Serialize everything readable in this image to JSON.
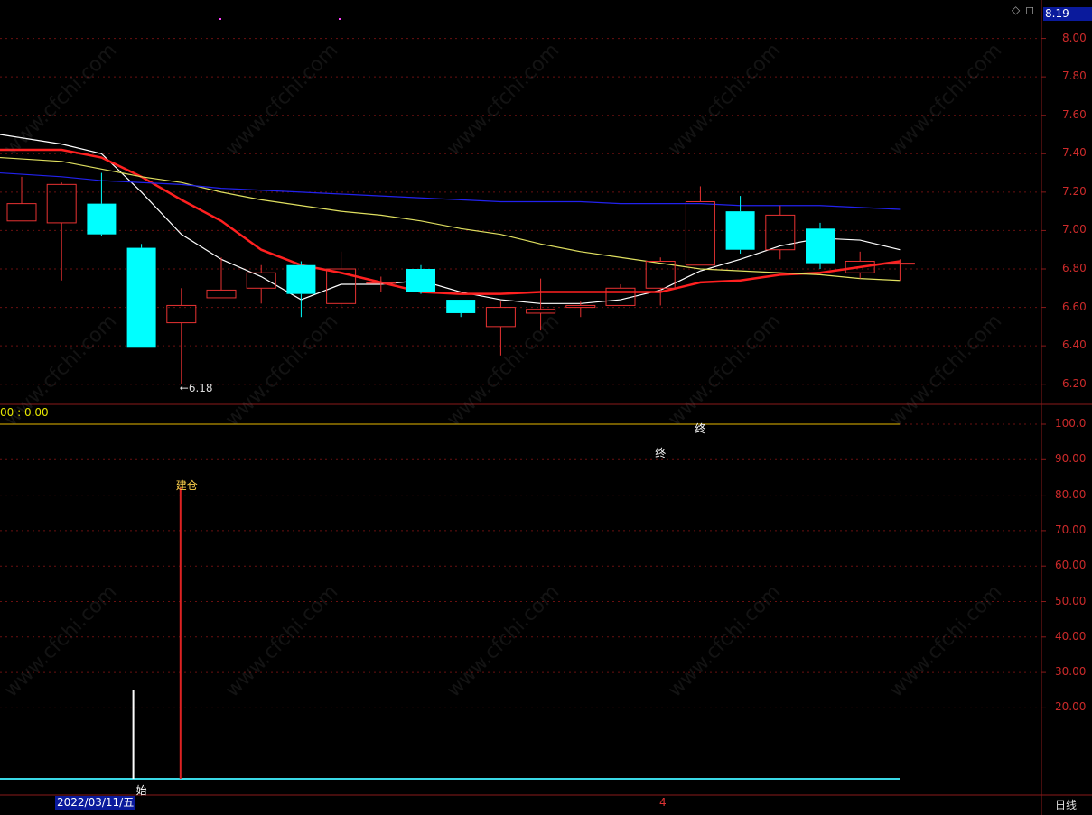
{
  "header": {
    "current_price": "8.19",
    "icons": [
      "diamond-icon",
      "window-icon"
    ]
  },
  "chart_data": [
    {
      "type": "candlestick",
      "panel": "price",
      "ylim": [
        6.1,
        8.2
      ],
      "yticks": [
        "8.00",
        "7.80",
        "7.60",
        "7.40",
        "7.20",
        "7.00",
        "6.80",
        "6.60",
        "6.40",
        "6.20"
      ],
      "candles": [
        {
          "o": 7.05,
          "h": 7.28,
          "l": 7.05,
          "c": 7.14
        },
        {
          "o": 7.04,
          "h": 7.25,
          "l": 6.74,
          "c": 7.24
        },
        {
          "o": 7.14,
          "h": 7.3,
          "l": 6.97,
          "c": 6.98
        },
        {
          "o": 6.91,
          "h": 6.93,
          "l": 6.39,
          "c": 6.39
        },
        {
          "o": 6.52,
          "h": 6.7,
          "l": 6.2,
          "c": 6.61
        },
        {
          "o": 6.65,
          "h": 6.86,
          "l": 6.65,
          "c": 6.69
        },
        {
          "o": 6.7,
          "h": 6.82,
          "l": 6.62,
          "c": 6.78
        },
        {
          "o": 6.82,
          "h": 6.84,
          "l": 6.55,
          "c": 6.67
        },
        {
          "o": 6.62,
          "h": 6.89,
          "l": 6.6,
          "c": 6.8
        },
        {
          "o": 6.73,
          "h": 6.76,
          "l": 6.68,
          "c": 6.73
        },
        {
          "o": 6.8,
          "h": 6.82,
          "l": 6.67,
          "c": 6.68
        },
        {
          "o": 6.64,
          "h": 6.64,
          "l": 6.55,
          "c": 6.57
        },
        {
          "o": 6.5,
          "h": 6.63,
          "l": 6.35,
          "c": 6.6
        },
        {
          "o": 6.57,
          "h": 6.75,
          "l": 6.48,
          "c": 6.59
        },
        {
          "o": 6.6,
          "h": 6.63,
          "l": 6.55,
          "c": 6.61
        },
        {
          "o": 6.61,
          "h": 6.72,
          "l": 6.61,
          "c": 6.7
        },
        {
          "o": 6.7,
          "h": 6.86,
          "l": 6.61,
          "c": 6.84
        },
        {
          "o": 6.82,
          "h": 7.23,
          "l": 6.82,
          "c": 7.15
        },
        {
          "o": 7.1,
          "h": 7.18,
          "l": 6.88,
          "c": 6.9
        },
        {
          "o": 6.9,
          "h": 7.13,
          "l": 6.85,
          "c": 7.08
        },
        {
          "o": 7.01,
          "h": 7.04,
          "l": 6.8,
          "c": 6.83
        },
        {
          "o": 6.78,
          "h": 6.89,
          "l": 6.75,
          "c": 6.84
        },
        {
          "o": 6.83,
          "h": 6.85,
          "l": 6.74,
          "c": 6.83
        }
      ],
      "moving_averages": [
        {
          "color": "#ffffff",
          "values": [
            7.5,
            7.45,
            7.4,
            7.2,
            6.98,
            6.85,
            6.76,
            6.64,
            6.72,
            6.72,
            6.74,
            6.68,
            6.64,
            6.62,
            6.62,
            6.64,
            6.69,
            6.79,
            6.85,
            6.92,
            6.96,
            6.95,
            6.9
          ]
        },
        {
          "color": "#ff2020",
          "values": [
            7.42,
            7.42,
            7.38,
            7.28,
            7.16,
            7.05,
            6.9,
            6.82,
            6.78,
            6.73,
            6.68,
            6.67,
            6.67,
            6.68,
            6.68,
            6.68,
            6.68,
            6.73,
            6.74,
            6.77,
            6.78,
            6.81,
            6.84
          ]
        },
        {
          "color": "#e0e060",
          "values": [
            7.38,
            7.36,
            7.32,
            7.28,
            7.25,
            7.2,
            7.16,
            7.13,
            7.1,
            7.08,
            7.05,
            7.01,
            6.98,
            6.93,
            6.89,
            6.86,
            6.83,
            6.8,
            6.79,
            6.78,
            6.77,
            6.75,
            6.74
          ]
        },
        {
          "color": "#2222ee",
          "values": [
            7.3,
            7.28,
            7.26,
            7.25,
            7.24,
            7.22,
            7.21,
            7.2,
            7.19,
            7.18,
            7.17,
            7.16,
            7.15,
            7.15,
            7.15,
            7.14,
            7.14,
            7.14,
            7.13,
            7.13,
            7.13,
            7.12,
            7.11
          ]
        }
      ],
      "annotations": [
        {
          "text": "←6.18",
          "candle_index": 4,
          "value": 6.18
        }
      ]
    },
    {
      "type": "bar",
      "panel": "indicator",
      "ylim": [
        0,
        105
      ],
      "yticks": [
        "100.0",
        "90.00",
        "80.00",
        "70.00",
        "60.00",
        "50.00",
        "40.00",
        "30.00",
        "20.00"
      ],
      "readout": "00 : 0.00",
      "reference_line": {
        "value": 100,
        "color": "#e6b800"
      },
      "base_line": {
        "value": 0,
        "color": "#3ad9e6"
      },
      "bars": [
        {
          "candle_index": 3,
          "value": 25,
          "color": "#ffffff"
        },
        {
          "candle_index": 4,
          "value": 82,
          "color": "#dd2222"
        }
      ],
      "labels": [
        {
          "text": "始",
          "candle_index": 3,
          "value": -3,
          "color": "#ffffff"
        },
        {
          "text": "建仓",
          "candle_index": 4,
          "value": 83,
          "color": "#ffd24d"
        },
        {
          "text": "终",
          "candle_index": 16,
          "value": 92,
          "color": "#ffffff"
        },
        {
          "text": "终",
          "candle_index": 17,
          "value": 99,
          "color": "#ffffff"
        }
      ]
    }
  ],
  "footer": {
    "cursor_date": "2022/03/11/五",
    "period_label": "日线",
    "marker": "4"
  },
  "watermark": "www.cfchi.com"
}
